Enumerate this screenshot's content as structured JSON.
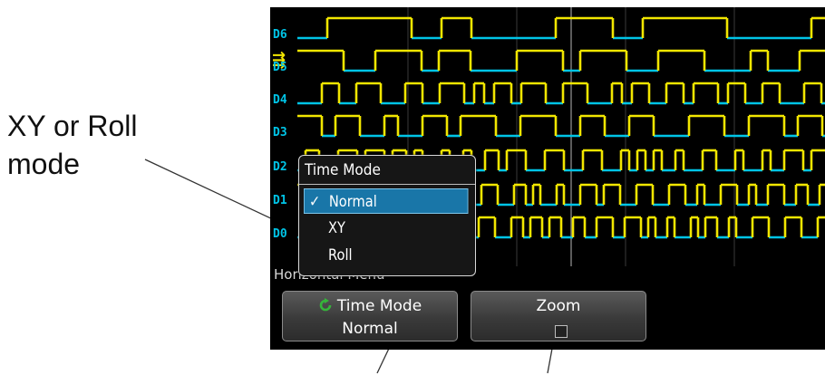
{
  "callout": {
    "text": "XY or Roll\nmode"
  },
  "channels": [
    "D5",
    "D4",
    "D3",
    "D2",
    "D1",
    "D0"
  ],
  "channel_label_d6": "D6",
  "menu": {
    "title": "Time Mode",
    "items": [
      {
        "label": "Normal",
        "selected": true
      },
      {
        "label": "XY",
        "selected": false
      },
      {
        "label": "Roll",
        "selected": false
      }
    ],
    "check_glyph": "✓"
  },
  "menu_caption": "Horizontal Menu",
  "softkeys": {
    "time_mode": {
      "title": "Time Mode",
      "value": "Normal",
      "icon": "refresh-icon"
    },
    "zoom": {
      "title": "Zoom",
      "checked": false
    }
  },
  "colors": {
    "trace_high": "#f2e600",
    "trace_low": "#00c4e6",
    "channel_label": "#00c4e6",
    "selected_item": "#1976a8",
    "icon_green": "#35b53a"
  }
}
